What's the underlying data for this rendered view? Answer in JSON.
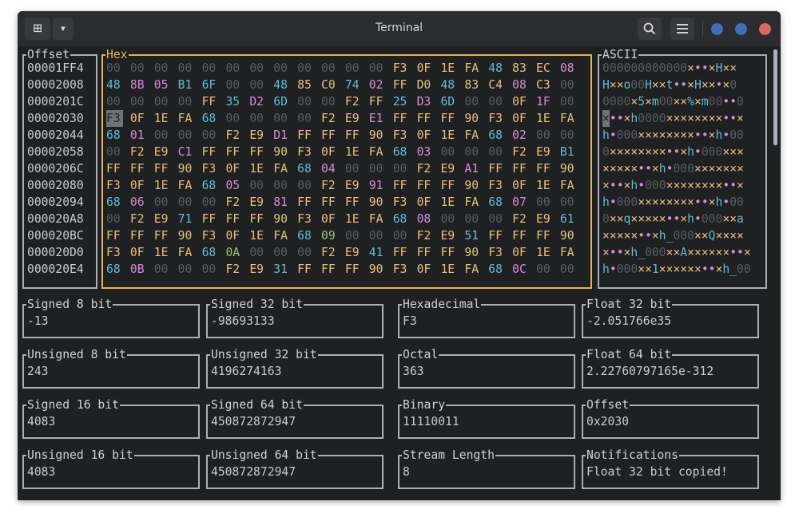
{
  "window": {
    "title": "Terminal",
    "new_tab_icon": "⊞",
    "dropdown_icon": "▾",
    "search_icon": "⌕",
    "menu_icon": "≡",
    "dot_colors": [
      "#3e6fb8",
      "#3e6fb8",
      "#e06666"
    ]
  },
  "panels": {
    "offset_title": "Offset",
    "hex_title": "Hex",
    "ascii_title": "ASCII"
  },
  "offsets": [
    "00001FF4",
    "00002008",
    "0000201C",
    "00002030",
    "00002044",
    "00002058",
    "0000206C",
    "00002080",
    "00002094",
    "000020A8",
    "000020BC",
    "000020D0",
    "000020E4"
  ],
  "hex_rows": [
    [
      "00",
      "00",
      "00",
      "00",
      "00",
      "00",
      "00",
      "00",
      "00",
      "00",
      "00",
      "00",
      "F3",
      "0F",
      "1E",
      "FA",
      "48",
      "83",
      "EC",
      "08"
    ],
    [
      "48",
      "8B",
      "05",
      "B1",
      "6F",
      "00",
      "00",
      "48",
      "85",
      "C0",
      "74",
      "02",
      "FF",
      "D0",
      "48",
      "83",
      "C4",
      "08",
      "C3",
      "00"
    ],
    [
      "00",
      "00",
      "00",
      "00",
      "FF",
      "35",
      "D2",
      "6D",
      "00",
      "00",
      "F2",
      "FF",
      "25",
      "D3",
      "6D",
      "00",
      "00",
      "0F",
      "1F",
      "00"
    ],
    [
      "F3",
      "0F",
      "1E",
      "FA",
      "68",
      "00",
      "00",
      "00",
      "00",
      "F2",
      "E9",
      "E1",
      "FF",
      "FF",
      "FF",
      "90",
      "F3",
      "0F",
      "1E",
      "FA"
    ],
    [
      "68",
      "01",
      "00",
      "00",
      "00",
      "F2",
      "E9",
      "D1",
      "FF",
      "FF",
      "FF",
      "90",
      "F3",
      "0F",
      "1E",
      "FA",
      "68",
      "02",
      "00",
      "00"
    ],
    [
      "00",
      "F2",
      "E9",
      "C1",
      "FF",
      "FF",
      "FF",
      "90",
      "F3",
      "0F",
      "1E",
      "FA",
      "68",
      "03",
      "00",
      "00",
      "00",
      "F2",
      "E9",
      "B1"
    ],
    [
      "FF",
      "FF",
      "FF",
      "90",
      "F3",
      "0F",
      "1E",
      "FA",
      "68",
      "04",
      "00",
      "00",
      "00",
      "F2",
      "E9",
      "A1",
      "FF",
      "FF",
      "FF",
      "90"
    ],
    [
      "F3",
      "0F",
      "1E",
      "FA",
      "68",
      "05",
      "00",
      "00",
      "00",
      "F2",
      "E9",
      "91",
      "FF",
      "FF",
      "FF",
      "90",
      "F3",
      "0F",
      "1E",
      "FA"
    ],
    [
      "68",
      "06",
      "00",
      "00",
      "00",
      "F2",
      "E9",
      "81",
      "FF",
      "FF",
      "FF",
      "90",
      "F3",
      "0F",
      "1E",
      "FA",
      "68",
      "07",
      "00",
      "00"
    ],
    [
      "00",
      "F2",
      "E9",
      "71",
      "FF",
      "FF",
      "FF",
      "90",
      "F3",
      "0F",
      "1E",
      "FA",
      "68",
      "08",
      "00",
      "00",
      "00",
      "F2",
      "E9",
      "61"
    ],
    [
      "FF",
      "FF",
      "FF",
      "90",
      "F3",
      "0F",
      "1E",
      "FA",
      "68",
      "09",
      "00",
      "00",
      "00",
      "F2",
      "E9",
      "51",
      "FF",
      "FF",
      "FF",
      "90"
    ],
    [
      "F3",
      "0F",
      "1E",
      "FA",
      "68",
      "0A",
      "00",
      "00",
      "00",
      "F2",
      "E9",
      "41",
      "FF",
      "FF",
      "FF",
      "90",
      "F3",
      "0F",
      "1E",
      "FA"
    ],
    [
      "68",
      "0B",
      "00",
      "00",
      "00",
      "F2",
      "E9",
      "31",
      "FF",
      "FF",
      "FF",
      "90",
      "F3",
      "0F",
      "1E",
      "FA",
      "68",
      "0C",
      "00",
      "00"
    ]
  ],
  "ascii_rows": [
    "000000000000×••×H××",
    "H××o00H××t••×H××•×0",
    "0000×5×m00××%×m00••0",
    "×••×h0000××××××××••×",
    "h•000××××××××••×h•00",
    "0××××××××••×h•000×××",
    "×××××••×h•000×××××××",
    "×••×h•000××××××××••×",
    "h•000××××××××••×h•00",
    "0××q×××××••×h•000××a",
    "×××××••×h_000××Q××××",
    "×••×h_000××A××××××••×",
    "h•000××1××××××••×h_00"
  ],
  "selected": {
    "row": 3,
    "col": 0
  },
  "fields": [
    {
      "label": "Signed 8 bit",
      "value": "-13"
    },
    {
      "label": "Signed 32 bit",
      "value": "-98693133"
    },
    {
      "label": "Hexadecimal",
      "value": "F3"
    },
    {
      "label": "Float 32 bit",
      "value": "-2.051766e35"
    },
    {
      "label": "Unsigned 8 bit",
      "value": "243"
    },
    {
      "label": "Unsigned 32 bit",
      "value": "4196274163"
    },
    {
      "label": "Octal",
      "value": "363"
    },
    {
      "label": "Float 64 bit",
      "value": "2.22760797165e-312"
    },
    {
      "label": "Signed 16 bit",
      "value": "4083"
    },
    {
      "label": "Signed 64 bit",
      "value": "450872872947"
    },
    {
      "label": "Binary",
      "value": "11110011"
    },
    {
      "label": "Offset",
      "value": "0x2030"
    },
    {
      "label": "Unsigned 16 bit",
      "value": "4083"
    },
    {
      "label": "Unsigned 64 bit",
      "value": "450872872947"
    },
    {
      "label": "Stream Length",
      "value": "8"
    },
    {
      "label": "Notifications",
      "value": "Float 32 bit copied!"
    }
  ]
}
